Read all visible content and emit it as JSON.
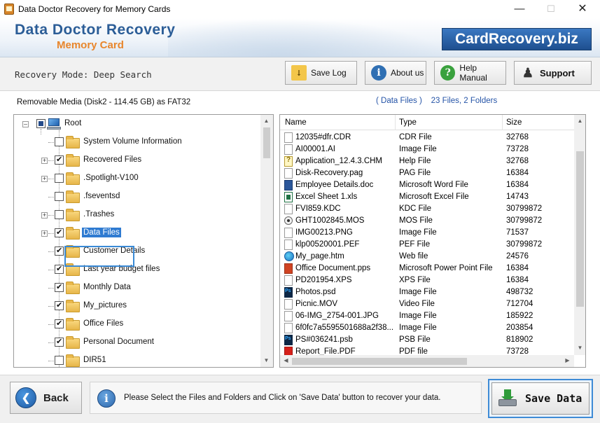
{
  "window": {
    "title": "Data Doctor Recovery for Memory Cards",
    "minimize": "—",
    "maximize": "☐",
    "close": "✕"
  },
  "header": {
    "brand_title": "Data Doctor Recovery",
    "brand_subtitle": "Memory Card",
    "website": "CardRecovery.biz"
  },
  "toolbar": {
    "mode": "Recovery Mode: Deep Search",
    "save_log": "Save Log",
    "about_us": "About us",
    "help_manual": "Help Manual",
    "support": "Support"
  },
  "media_info": "Removable Media (Disk2 - 114.45 GB) as FAT32",
  "summary": {
    "folder": "( Data Files )",
    "counts": "23 Files, 2 Folders"
  },
  "tree": {
    "root": "Root",
    "items": [
      {
        "label": "System Volume Information",
        "checked": false,
        "expandable": false
      },
      {
        "label": "Recovered Files",
        "checked": true,
        "expandable": true
      },
      {
        "label": ".Spotlight-V100",
        "checked": false,
        "expandable": true
      },
      {
        "label": ".fseventsd",
        "checked": false,
        "expandable": false
      },
      {
        "label": ".Trashes",
        "checked": false,
        "expandable": true
      },
      {
        "label": "Data Files",
        "checked": true,
        "expandable": true,
        "selected": true
      },
      {
        "label": "Customer Details",
        "checked": true,
        "expandable": false
      },
      {
        "label": "Last year budget files",
        "checked": true,
        "expandable": false
      },
      {
        "label": "Monthly Data",
        "checked": true,
        "expandable": false
      },
      {
        "label": "My_pictures",
        "checked": true,
        "expandable": false
      },
      {
        "label": "Office Files",
        "checked": true,
        "expandable": false
      },
      {
        "label": "Personal Document",
        "checked": true,
        "expandable": false
      },
      {
        "label": "DIR51",
        "checked": false,
        "expandable": false
      }
    ]
  },
  "file_list": {
    "columns": [
      "Name",
      "Type",
      "Size"
    ],
    "rows": [
      {
        "name": "12035#dfr.CDR",
        "type": "CDR File",
        "size": "32768",
        "icon": "generic-file-icon"
      },
      {
        "name": "AI00001.AI",
        "type": "Image File",
        "size": "73728",
        "icon": "generic-file-icon"
      },
      {
        "name": "Application_12.4.3.CHM",
        "type": "Help File",
        "size": "32768",
        "icon": "help-file-icon"
      },
      {
        "name": "Disk-Recovery.pag",
        "type": "PAG File",
        "size": "16384",
        "icon": "generic-file-icon"
      },
      {
        "name": "Employee Details.doc",
        "type": "Microsoft Word File",
        "size": "16384",
        "icon": "word-file-icon"
      },
      {
        "name": "Excel Sheet 1.xls",
        "type": "Microsoft Excel File",
        "size": "14743",
        "icon": "excel-file-icon"
      },
      {
        "name": "FVI859.KDC",
        "type": "KDC File",
        "size": "30799872",
        "icon": "generic-file-icon"
      },
      {
        "name": "GHT1002845.MOS",
        "type": "MOS File",
        "size": "30799872",
        "icon": "mos-file-icon"
      },
      {
        "name": "IMG00213.PNG",
        "type": "Image File",
        "size": "71537",
        "icon": "generic-file-icon"
      },
      {
        "name": "klp00520001.PEF",
        "type": "PEF File",
        "size": "30799872",
        "icon": "generic-file-icon"
      },
      {
        "name": "My_page.htm",
        "type": "Web file",
        "size": "24576",
        "icon": "web-file-icon"
      },
      {
        "name": "Office Document.pps",
        "type": "Microsoft Power Point File",
        "size": "16384",
        "icon": "powerpoint-file-icon"
      },
      {
        "name": "PD201954.XPS",
        "type": "XPS File",
        "size": "16384",
        "icon": "generic-file-icon"
      },
      {
        "name": "Photos.psd",
        "type": "Image File",
        "size": "498732",
        "icon": "photoshop-file-icon"
      },
      {
        "name": "Picnic.MOV",
        "type": "Video File",
        "size": "712704",
        "icon": "generic-file-icon"
      },
      {
        "name": "06-IMG_2754-001.JPG",
        "type": "Image File",
        "size": "185922",
        "icon": "generic-file-icon"
      },
      {
        "name": "6f0fc7a5595501688a2f38...",
        "type": "Image File",
        "size": "203854",
        "icon": "generic-file-icon"
      },
      {
        "name": "PS#036241.psb",
        "type": "PSB File",
        "size": "818902",
        "icon": "photoshop-file-icon"
      },
      {
        "name": "Report_File.PDF",
        "type": "PDF file",
        "size": "73728",
        "icon": "pdf-file-icon"
      }
    ]
  },
  "footer": {
    "back": "Back",
    "hint": "Please Select the Files and Folders and Click on 'Save Data' button to recover your data.",
    "save_data": "Save Data"
  },
  "colors": {
    "brand_blue": "#2b5d97",
    "brand_orange": "#e8862c",
    "selection": "#2f7bd1",
    "summary_text": "#2554a7"
  }
}
